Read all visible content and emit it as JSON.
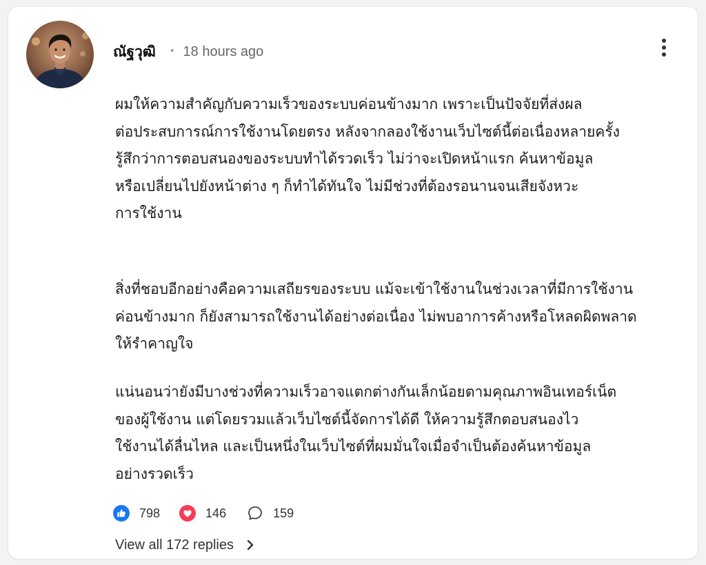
{
  "comment": {
    "author": "ณัฐวุฒิ",
    "separator": "•",
    "time": "18 hours ago",
    "paragraphs": [
      {
        "lines": [
          "ผมให้ความสำคัญกับความเร็วของระบบค่อนข้างมาก เพราะเป็นปัจจัยที่ส่งผล",
          "ต่อประสบการณ์การใช้งานโดยตรง หลังจากลองใช้งานเว็บไซต์นี้ต่อเนื่องหลายครั้ง",
          "รู้สึกว่าการตอบสนองของระบบทำได้รวดเร็ว ไม่ว่าจะเปิดหน้าแรก ค้นหาข้อมูล",
          "หรือเปลี่ยนไปยังหน้าต่าง ๆ ก็ทำได้ทันใจ ไม่มีช่วงที่ต้องรอนานจนเสียจังหวะ",
          "การใช้งาน"
        ]
      },
      {
        "lines": [
          "สิ่งที่ชอบอีกอย่างคือความเสถียรของระบบ แม้จะเข้าใช้งานในช่วงเวลาที่มีการใช้งาน",
          "ค่อนข้างมาก ก็ยังสามารถใช้งานได้อย่างต่อเนื่อง ไม่พบอาการค้างหรือโหลดผิดพลาด",
          "ให้รำคาญใจ"
        ]
      },
      {
        "lines": [
          "แน่นอนว่ายังมีบางช่วงที่ความเร็วอาจแตกต่างกันเล็กน้อยตามคุณภาพอินเทอร์เน็ต",
          "ของผู้ใช้งาน แต่โดยรวมแล้วเว็บไซต์นี้จัดการได้ดี ให้ความรู้สึกตอบสนองไว",
          "ใช้งานได้ลื่นไหล และเป็นหนึ่งในเว็บไซต์ที่ผมมั่นใจเมื่อจำเป็นต้องค้นหาข้อมูล",
          "อย่างรวดเร็ว"
        ]
      }
    ],
    "reactions": {
      "likes": "798",
      "hearts": "146",
      "comments": "159"
    },
    "view_replies_label": "View all 172 replies"
  },
  "icons": {
    "more": "more-vertical-icon",
    "like": "thumbs-up-icon",
    "heart": "heart-icon",
    "comment": "comment-bubble-icon",
    "chevron": "chevron-right-icon"
  },
  "colors": {
    "like_blue": "#1877f2",
    "heart_red": "#f33e58",
    "text": "#1b1b1b",
    "muted": "#666666"
  }
}
